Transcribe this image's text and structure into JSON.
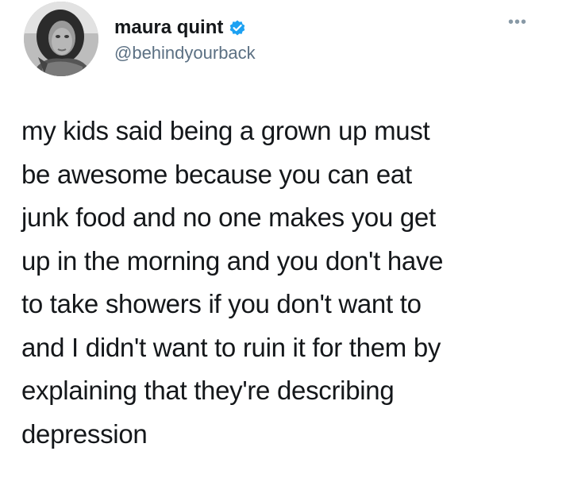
{
  "author": {
    "display_name": "maura quint",
    "handle": "@behindyourback",
    "verified": true,
    "avatar": "profile-photo"
  },
  "menu": {
    "more_label": "•••",
    "more_icon": "more-horizontal-icon"
  },
  "tweet": {
    "lines": [
      "my kids said being a grown up must",
      "be awesome because you can eat",
      "junk food and no one makes you get",
      "up in the morning and you don't have",
      "to take showers if you don't want to",
      "and I didn't want to ruin it for them by",
      "explaining that they're describing",
      "depression"
    ]
  },
  "colors": {
    "text": "#14171a",
    "secondary": "#5b7083",
    "verified_blue": "#1da1f2",
    "background": "#ffffff",
    "more_dots": "#8899a6"
  }
}
